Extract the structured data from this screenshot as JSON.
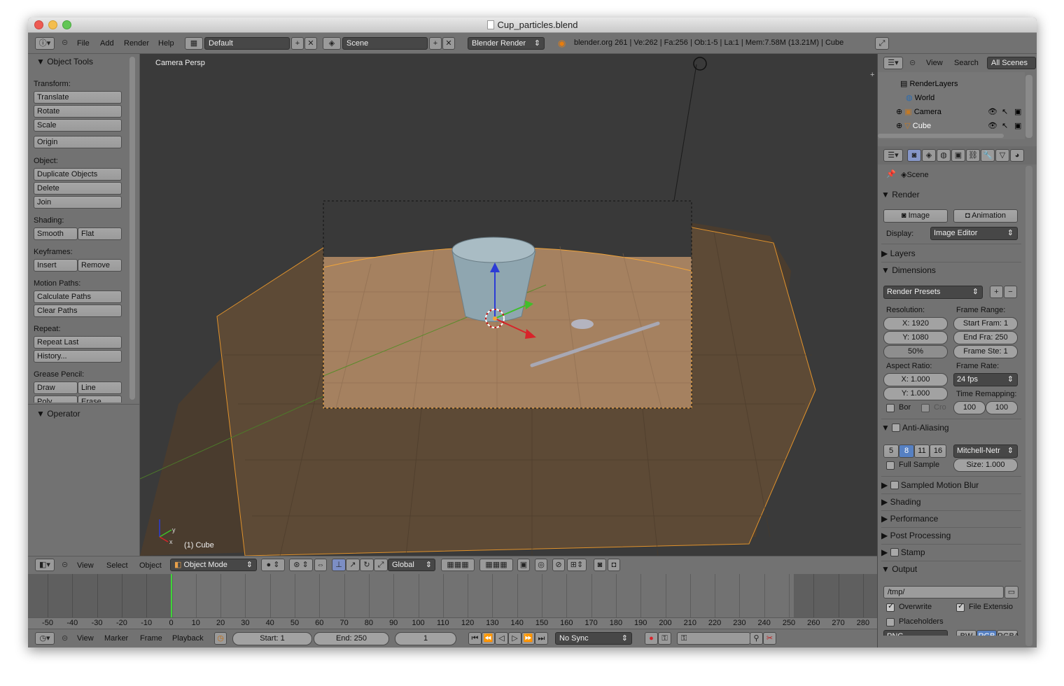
{
  "window": {
    "title": "Cup_particles.blend"
  },
  "info": {
    "menus": [
      "File",
      "Add",
      "Render",
      "Help"
    ],
    "screen_layout": "Default",
    "scene": "Scene",
    "engine": "Blender Render",
    "stats": "blender.org 261 | Ve:262 | Fa:256 | Ob:1-5 | La:1 | Mem:7.58M (13.21M) | Cube"
  },
  "tools": {
    "title": "Object Tools",
    "transform": "Transform:",
    "translate": "Translate",
    "rotate": "Rotate",
    "scale": "Scale",
    "origin": "Origin",
    "object": "Object:",
    "duplicate": "Duplicate Objects",
    "delete": "Delete",
    "join": "Join",
    "shading": "Shading:",
    "smooth": "Smooth",
    "flat": "Flat",
    "keyframes": "Keyframes:",
    "insert": "Insert",
    "remove": "Remove",
    "motion": "Motion Paths:",
    "calc": "Calculate Paths",
    "clear": "Clear Paths",
    "repeat": "Repeat:",
    "repeat_last": "Repeat Last",
    "history": "History...",
    "grease": "Grease Pencil:",
    "draw": "Draw",
    "line": "Line",
    "poly": "Poly",
    "erase": "Erase",
    "operator": "Operator"
  },
  "viewport": {
    "label": "Camera Persp",
    "object": "(1) Cube"
  },
  "view3d_header": {
    "menus": [
      "View",
      "Select",
      "Object"
    ],
    "mode": "Object Mode",
    "orientation": "Global"
  },
  "timeline": {
    "ticks": [
      "-50",
      "-40",
      "-30",
      "-20",
      "-10",
      "0",
      "10",
      "20",
      "30",
      "40",
      "50",
      "60",
      "70",
      "80",
      "90",
      "100",
      "110",
      "120",
      "130",
      "140",
      "150",
      "160",
      "170",
      "180",
      "190",
      "200",
      "210",
      "220",
      "230",
      "240",
      "250",
      "260",
      "270",
      "280"
    ],
    "current": 0,
    "start": 1,
    "end": 250
  },
  "timeline_header": {
    "menus": [
      "View",
      "Marker",
      "Frame",
      "Playback"
    ],
    "start": "Start: 1",
    "end": "End: 250",
    "frame": "1",
    "sync": "No Sync"
  },
  "outliner": {
    "menus": [
      "View",
      "Search"
    ],
    "filter": "All Scenes",
    "items": [
      "RenderLayers",
      "World",
      "Camera",
      "Cube"
    ]
  },
  "properties": {
    "context": "Scene",
    "render": "Render",
    "image": "Image",
    "animation": "Animation",
    "display_label": "Display:",
    "display": "Image Editor",
    "layers": "Layers",
    "dimensions": "Dimensions",
    "presets": "Render Presets",
    "resolution": "Resolution:",
    "frame_range": "Frame Range:",
    "res_x": "X: 1920",
    "res_y": "Y: 1080",
    "res_pct": "50%",
    "start_frame": "Start Fram: 1",
    "end_frame": "End Fra: 250",
    "frame_step": "Frame Ste: 1",
    "aspect": "Aspect Ratio:",
    "frame_rate": "Frame Rate:",
    "asp_x": "X: 1.000",
    "asp_y": "Y: 1.000",
    "fps": "24 fps",
    "remap": "Time Remapping:",
    "bor": "Bor",
    "cro": "Cro",
    "remap_old": "100",
    "remap_new": "100",
    "aa": "Anti-Aliasing",
    "aa_samples": [
      "5",
      "8",
      "11",
      "16"
    ],
    "aa_filter": "Mitchell-Netr",
    "full_sample": "Full Sample",
    "aa_size": "Size: 1.000",
    "mblur": "Sampled Motion Blur",
    "shading": "Shading",
    "performance": "Performance",
    "post": "Post Processing",
    "stamp": "Stamp",
    "output": "Output",
    "path": "/tmp/",
    "overwrite": "Overwrite",
    "file_ext": "File Extensio",
    "placeholders": "Placeholders",
    "format": "PNG",
    "bw": "BW",
    "rgb": "RGB",
    "rgba": "RGBA"
  },
  "colors": {
    "accent": "#5680c2",
    "viewport_bg": "#3a3a3a",
    "floor": "#a58160",
    "selection": "#f2a53a"
  }
}
